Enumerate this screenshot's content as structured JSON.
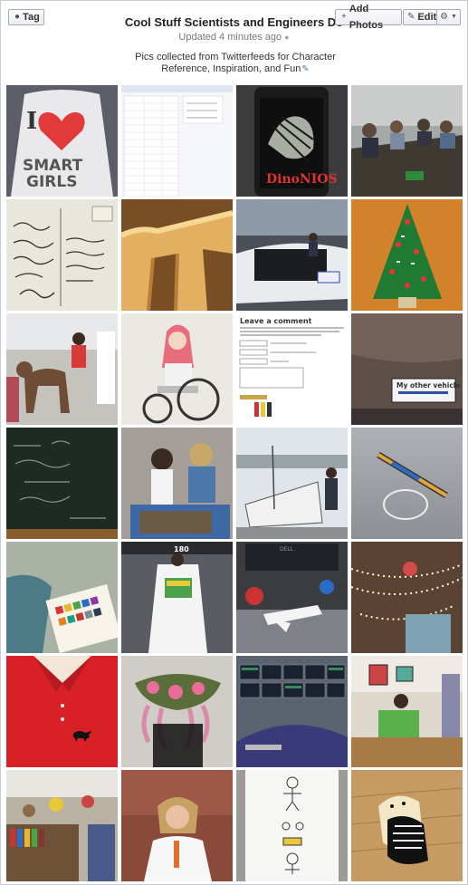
{
  "header": {
    "tag_label": "Tag",
    "add_photos_label": "Add Photos",
    "edit_label": "Edit",
    "album_title": "Cool Stuff Scientists and Engineers Do",
    "updated": "Updated 4 minutes ago",
    "description": "Pics collected from Twitterfeeds for Character Reference, Inspiration, and Fun"
  },
  "photos": [
    {
      "subject": "i-heart-smart-girls-shirt",
      "overlay": ""
    },
    {
      "subject": "spreadsheet-screenshot",
      "overlay": ""
    },
    {
      "subject": "dino-book-phone",
      "overlay": "DinoNIOS"
    },
    {
      "subject": "meeting-room",
      "overlay": ""
    },
    {
      "subject": "handwritten-postcard",
      "overlay": ""
    },
    {
      "subject": "pi-pie",
      "overlay": ""
    },
    {
      "subject": "car-trunk-electronics",
      "overlay": ""
    },
    {
      "subject": "circuit-board-tree",
      "overlay": ""
    },
    {
      "subject": "kids-with-pony",
      "overlay": ""
    },
    {
      "subject": "woman-in-wheelchair-laptop",
      "overlay": ""
    },
    {
      "subject": "leave-a-comment-form",
      "overlay": ""
    },
    {
      "subject": "car-bumper-sticker",
      "overlay": "My other vehicle"
    },
    {
      "subject": "chalkboard-equations",
      "overlay": ""
    },
    {
      "subject": "girl-and-scientist-fossils",
      "overlay": ""
    },
    {
      "subject": "sailboat-drone",
      "overlay": ""
    },
    {
      "subject": "ring-pen-sculpture",
      "overlay": ""
    },
    {
      "subject": "watercolor-painting",
      "overlay": ""
    },
    {
      "subject": "lab-coat-in-bus",
      "overlay": ""
    },
    {
      "subject": "toy-space-shuttle",
      "overlay": ""
    },
    {
      "subject": "christmas-lights-office",
      "overlay": ""
    },
    {
      "subject": "red-polo-dino-logo",
      "overlay": ""
    },
    {
      "subject": "crochet-tentacle-scarf",
      "overlay": ""
    },
    {
      "subject": "control-room",
      "overlay": ""
    },
    {
      "subject": "office-desk-laptop",
      "overlay": ""
    },
    {
      "subject": "library-office-models",
      "overlay": ""
    },
    {
      "subject": "woman-portrait",
      "overlay": ""
    },
    {
      "subject": "stick-figure-poster",
      "overlay": ""
    },
    {
      "subject": "dog-skeleton-sweater",
      "overlay": ""
    }
  ]
}
